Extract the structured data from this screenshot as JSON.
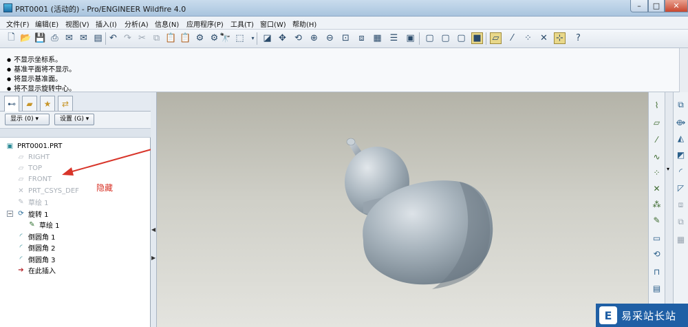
{
  "window": {
    "title": "PRT0001 (活动的) - Pro/ENGINEER Wildfire 4.0",
    "minimize": "–",
    "maximize": "□",
    "close": "✕"
  },
  "menu": [
    "文件(F)",
    "编辑(E)",
    "视图(V)",
    "插入(I)",
    "分析(A)",
    "信息(N)",
    "应用程序(P)",
    "工具(T)",
    "窗口(W)",
    "帮助(H)"
  ],
  "messages": [
    "不显示坐标系。",
    "基准平面将不显示。",
    "将显示基准面。",
    "将不显示旋转中心。"
  ],
  "navigator": {
    "show_button": "显示 (0) ▾",
    "settings_button": "设置 (G) ▾",
    "tree": [
      {
        "label": "PRT0001.PRT",
        "icon": "part-icon",
        "hidden": false
      },
      {
        "label": "RIGHT",
        "icon": "datum-plane-icon",
        "hidden": true
      },
      {
        "label": "TOP",
        "icon": "datum-plane-icon",
        "hidden": true
      },
      {
        "label": "FRONT",
        "icon": "datum-plane-icon",
        "hidden": true
      },
      {
        "label": "PRT_CSYS_DEF",
        "icon": "csys-icon",
        "hidden": true
      },
      {
        "label": "草绘 1",
        "icon": "sketch-icon",
        "hidden": true
      },
      {
        "label": "旋转 1",
        "icon": "revolve-icon",
        "hidden": false
      },
      {
        "label": "草绘 1",
        "icon": "sketch-icon",
        "hidden": false
      },
      {
        "label": "倒圆角 1",
        "icon": "round-icon",
        "hidden": false
      },
      {
        "label": "倒圆角 2",
        "icon": "round-icon",
        "hidden": false
      },
      {
        "label": "倒圆角 3",
        "icon": "round-icon",
        "hidden": false
      },
      {
        "label": "在此插入",
        "icon": "insert-here-icon",
        "hidden": false
      }
    ]
  },
  "annotation": {
    "text": "隐藏",
    "color": "#d8352a"
  },
  "watermark": {
    "text": "易采站长站"
  },
  "colors": {
    "model": "#9aa7b1",
    "viewport_top": "#b4b3a8",
    "viewport_bottom": "#e4e4df"
  }
}
